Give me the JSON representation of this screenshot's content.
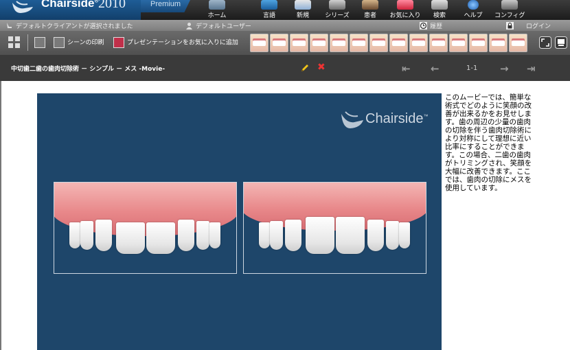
{
  "app": {
    "name": "Chairside",
    "trademark": "®",
    "year": "2010",
    "edition": "Premium"
  },
  "nav": [
    {
      "label": "ホーム",
      "icon": "home-chair-icon"
    },
    {
      "label": "言語",
      "icon": "language-flag-icon"
    },
    {
      "label": "新規",
      "icon": "new-presentation-icon"
    },
    {
      "label": "シリーズ",
      "icon": "series-film-icon"
    },
    {
      "label": "患者",
      "icon": "patient-icon"
    },
    {
      "label": "お気に入り",
      "icon": "favorites-heart-icon"
    },
    {
      "label": "検索",
      "icon": "search-icon"
    },
    {
      "label": "ヘルプ",
      "icon": "help-icon"
    },
    {
      "label": "コンフィグ",
      "icon": "config-icon"
    }
  ],
  "status": {
    "client": "デフォルトクライアントが選択されました",
    "user": "デフォルトユーザー",
    "history": "履歴",
    "login": "ログイン"
  },
  "toolbar": {
    "print_scene": "シーンの印刷",
    "add_favorite": "プレゼンテーションをお気に入りに追加"
  },
  "title": {
    "text": "中切歯二歯の歯肉切除術 － シンプル － メス -Movie-",
    "pager": "1-1"
  },
  "movie": {
    "watermark": "Chairside",
    "watermark_tm": "™"
  },
  "description": "このムービーでは、簡単な術式でどのように笑顔の改善が出来るかをお見せします。歯の周辺の少量の歯肉の切除を伴う歯肉切除術により対称にして理想に近い比率にすることができます。この場合、二歯の歯肉がトリミングされ、笑顔を大幅に改善できます。ここでは、歯肉の切除にメスを使用しています。",
  "colors": {
    "movie_bg": "#1e466a",
    "top_bar": "#2a2a2a",
    "brand_blue": "#1a5a94",
    "delete_red": "#e33333",
    "edit_yellow": "#f0c419"
  }
}
